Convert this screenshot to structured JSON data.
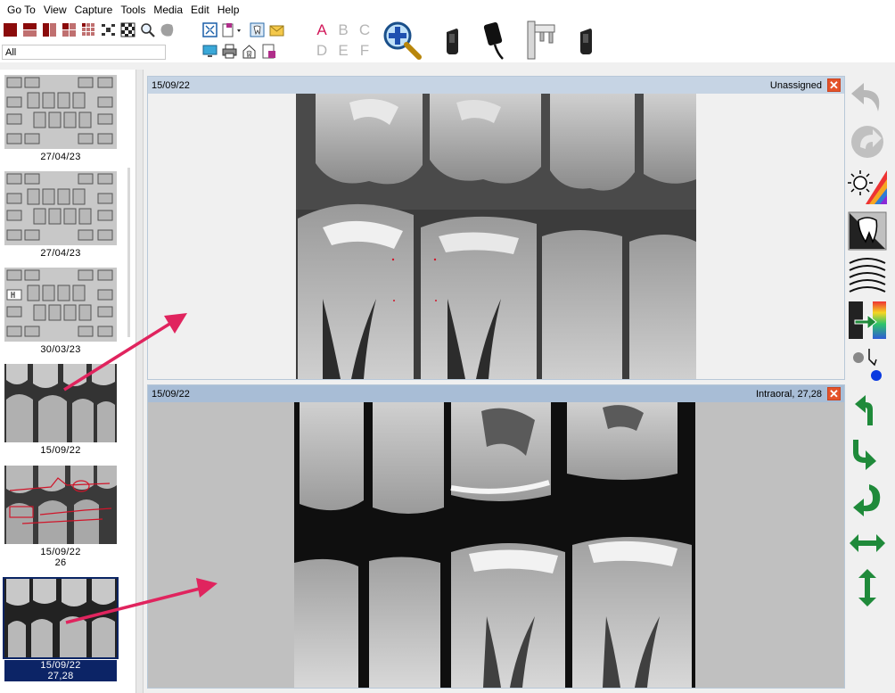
{
  "menu": {
    "items": [
      "Go To",
      "View",
      "Capture",
      "Tools",
      "Media",
      "Edit",
      "Help"
    ]
  },
  "toolbar": {
    "letters": [
      "A",
      "B",
      "C",
      "D",
      "E",
      "F"
    ],
    "active_letter": "A"
  },
  "search": {
    "value": "All"
  },
  "thumbnails": [
    {
      "date": "27/04/23",
      "sub": ""
    },
    {
      "date": "27/04/23",
      "sub": ""
    },
    {
      "date": "30/03/23",
      "sub": ""
    },
    {
      "date": "15/09/22",
      "sub": ""
    },
    {
      "date": "15/09/22",
      "sub": "26"
    },
    {
      "date": "15/09/22",
      "sub": "27,28"
    }
  ],
  "viewer": {
    "top": {
      "date": "15/09/22",
      "label": "Unassigned",
      "close": "✕"
    },
    "bottom": {
      "date": "15/09/22",
      "label": "Intraoral, 27,28",
      "close": "✕"
    }
  },
  "colors": {
    "accent_arrow": "#e0245e",
    "selection": "#0c2466",
    "green_tool": "#1f8a3a",
    "close": "#e4532a"
  }
}
